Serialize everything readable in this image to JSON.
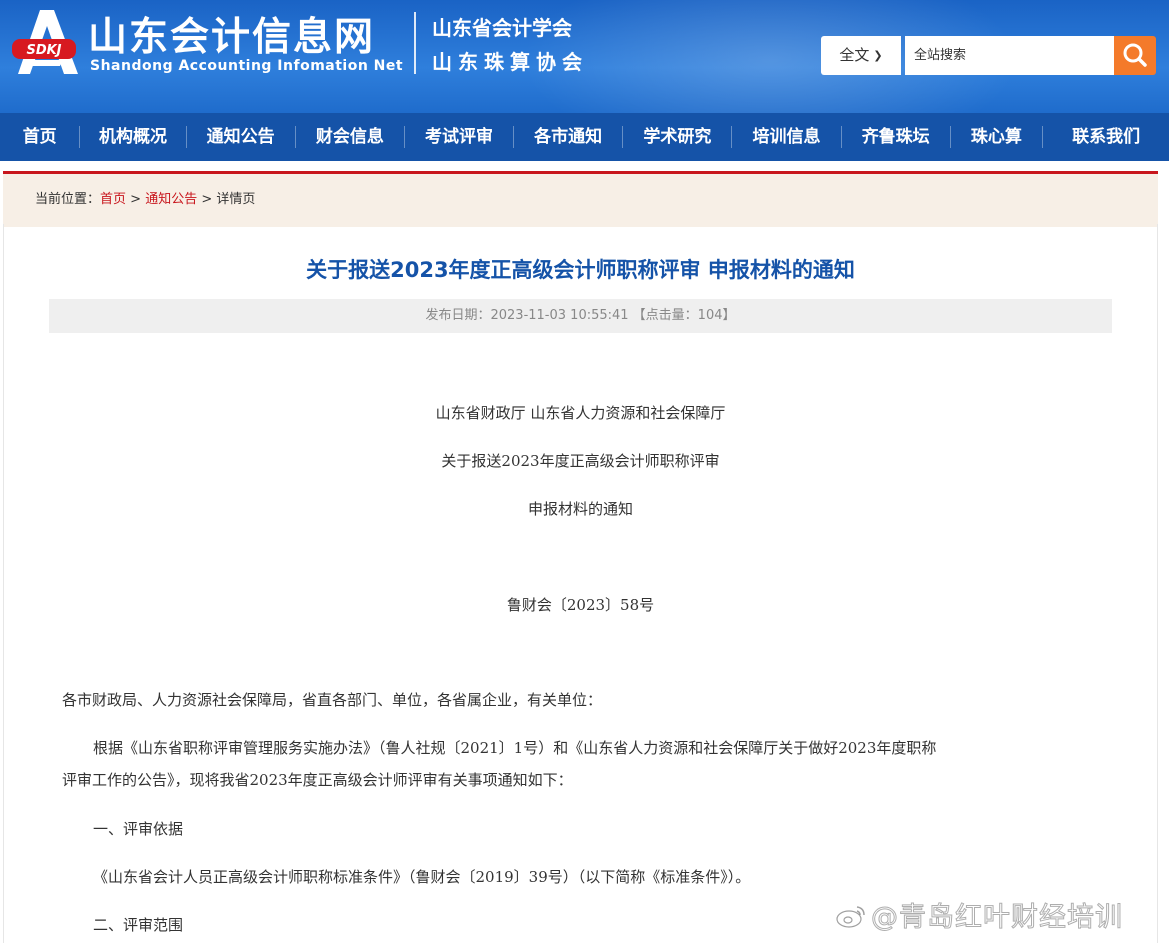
{
  "header": {
    "logo_badge": "SDKJ",
    "site_title": "山东会计信息网",
    "site_subtitle": "Shandong Accounting Infomation Net",
    "assoc_line1": "山东省会计学会",
    "assoc_line2": "山东珠算协会"
  },
  "search": {
    "scope": "全文",
    "placeholder": "全站搜索"
  },
  "nav": {
    "items": [
      "首页",
      "机构概况",
      "通知公告",
      "财会信息",
      "考试评审",
      "各市通知",
      "学术研究",
      "培训信息",
      "齐鲁珠坛",
      "珠心算",
      "联系我们"
    ]
  },
  "breadcrumb": {
    "prefix": "当前位置：",
    "home": "首页",
    "sep1": " > ",
    "section": "通知公告",
    "sep2": " > ",
    "current": "详情页"
  },
  "article": {
    "title": "关于报送2023年度正高级会计师职称评审 申报材料的通知",
    "meta": "发布日期：2023-11-03 10:55:41  【点击量：104】",
    "issuers": "山东省财政厅    山东省人力资源和社会保障厅",
    "heading_line1": "关于报送2023年度正高级会计师职称评审",
    "heading_line2": "申报材料的通知",
    "doc_number": "鲁财会〔2023〕58号",
    "salutation": "各市财政局、人力资源社会保障局，省直各部门、单位，各省属企业，有关单位：",
    "para1_line1": "根据《山东省职称评审管理服务实施办法》（鲁人社规〔2021〕1号）和《山东省人力资源和社会保障厅关于做好2023年度职称",
    "para1_line2": "评审工作的公告》，现将我省2023年度正高级会计师评审有关事项通知如下：",
    "section1": "一、评审依据",
    "section1_text": "《山东省会计人员正高级会计师职称标准条件》（鲁财会〔2019〕39号）（以下简称《标准条件》）。",
    "section2": "二、评审范围"
  },
  "watermark": {
    "text": "@青岛红叶财经培训",
    "icon": "weibo-icon"
  },
  "colors": {
    "header_blue": "#1a63c5",
    "nav_blue": "#1553a8",
    "title_blue": "#1553a8",
    "accent_red": "#c8161d",
    "search_orange": "#f47a2a",
    "crumb_bg": "#f7efe6"
  }
}
